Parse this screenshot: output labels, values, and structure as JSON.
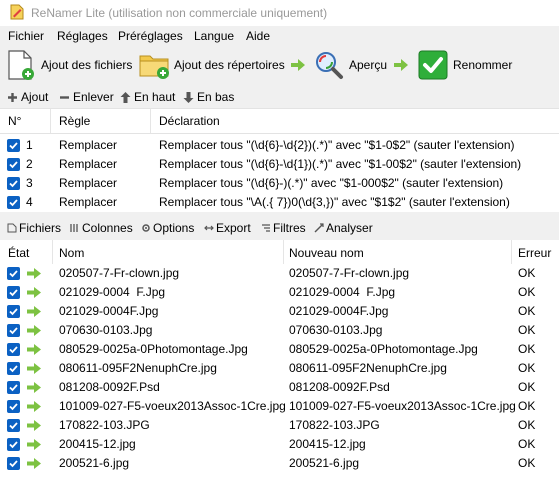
{
  "window": {
    "title": "ReNamer Lite (utilisation non commerciale uniquement)"
  },
  "menu": [
    "Fichier",
    "Réglages",
    "Préréglages",
    "Langue",
    "Aide"
  ],
  "toolbar": {
    "add_files": "Ajout des fichiers",
    "add_folders": "Ajout des répertoires",
    "preview": "Aperçu",
    "rename": "Renommer"
  },
  "rules_toolbar": {
    "add": "Ajout",
    "remove": "Enlever",
    "up": "En haut",
    "down": "En bas"
  },
  "rules_table": {
    "headers": [
      "N°",
      "Règle",
      "Déclaration"
    ],
    "rows": [
      {
        "num": "1",
        "rule": "Remplacer",
        "declaration": "Remplacer tous \"(\\d{6}-\\d{2})(.*)\" avec \"$1-0$2\" (sauter l'extension)",
        "checked": true
      },
      {
        "num": "2",
        "rule": "Remplacer",
        "declaration": "Remplacer tous \"(\\d{6}-\\d{1})(.*)\" avec \"$1-00$2\" (sauter l'extension)",
        "checked": true
      },
      {
        "num": "3",
        "rule": "Remplacer",
        "declaration": "Remplacer tous \"(\\d{6}-)(.*)\" avec \"$1-000$2\" (sauter l'extension)",
        "checked": true
      },
      {
        "num": "4",
        "rule": "Remplacer",
        "declaration": "Remplacer tous \"\\A(.{ 7})0(\\d{3,})\" avec \"$1$2\" (sauter l'extension)",
        "checked": true
      }
    ]
  },
  "files_toolbar": {
    "files": "Fichiers",
    "columns": "Colonnes",
    "options": "Options",
    "export": "Export",
    "filters": "Filtres",
    "analyze": "Analyser"
  },
  "files_table": {
    "headers": [
      "État",
      "Nom",
      "Nouveau nom",
      "Erreur"
    ],
    "rows": [
      {
        "name": "020507-7-Fr-clown.jpg",
        "new_name": "020507-7-Fr-clown.jpg",
        "error": "OK"
      },
      {
        "name": "021029-0004  F.Jpg",
        "new_name": "021029-0004  F.Jpg",
        "error": "OK"
      },
      {
        "name": "021029-0004F.Jpg",
        "new_name": "021029-0004F.Jpg",
        "error": "OK"
      },
      {
        "name": "070630-0103.Jpg",
        "new_name": "070630-0103.Jpg",
        "error": "OK"
      },
      {
        "name": "080529-0025a-0Photomontage.Jpg",
        "new_name": "080529-0025a-0Photomontage.Jpg",
        "error": "OK"
      },
      {
        "name": "080611-095F2NenuphCre.jpg",
        "new_name": "080611-095F2NenuphCre.jpg",
        "error": "OK"
      },
      {
        "name": "081208-0092F.Psd",
        "new_name": "081208-0092F.Psd",
        "error": "OK"
      },
      {
        "name": "101009-027-F5-voeux2013Assoc-1Cre.jpg",
        "new_name": "101009-027-F5-voeux2013Assoc-1Cre.jpg",
        "error": "OK"
      },
      {
        "name": "170822-103.JPG",
        "new_name": "170822-103.JPG",
        "error": "OK"
      },
      {
        "name": "200415-12.jpg",
        "new_name": "200415-12.jpg",
        "error": "OK"
      },
      {
        "name": "200521-6.jpg",
        "new_name": "200521-6.jpg",
        "error": "OK"
      }
    ]
  },
  "colors": {
    "checkbox": "#0b61c3",
    "arrow_green": "#7dc242",
    "rename_green": "#2fae3a"
  }
}
